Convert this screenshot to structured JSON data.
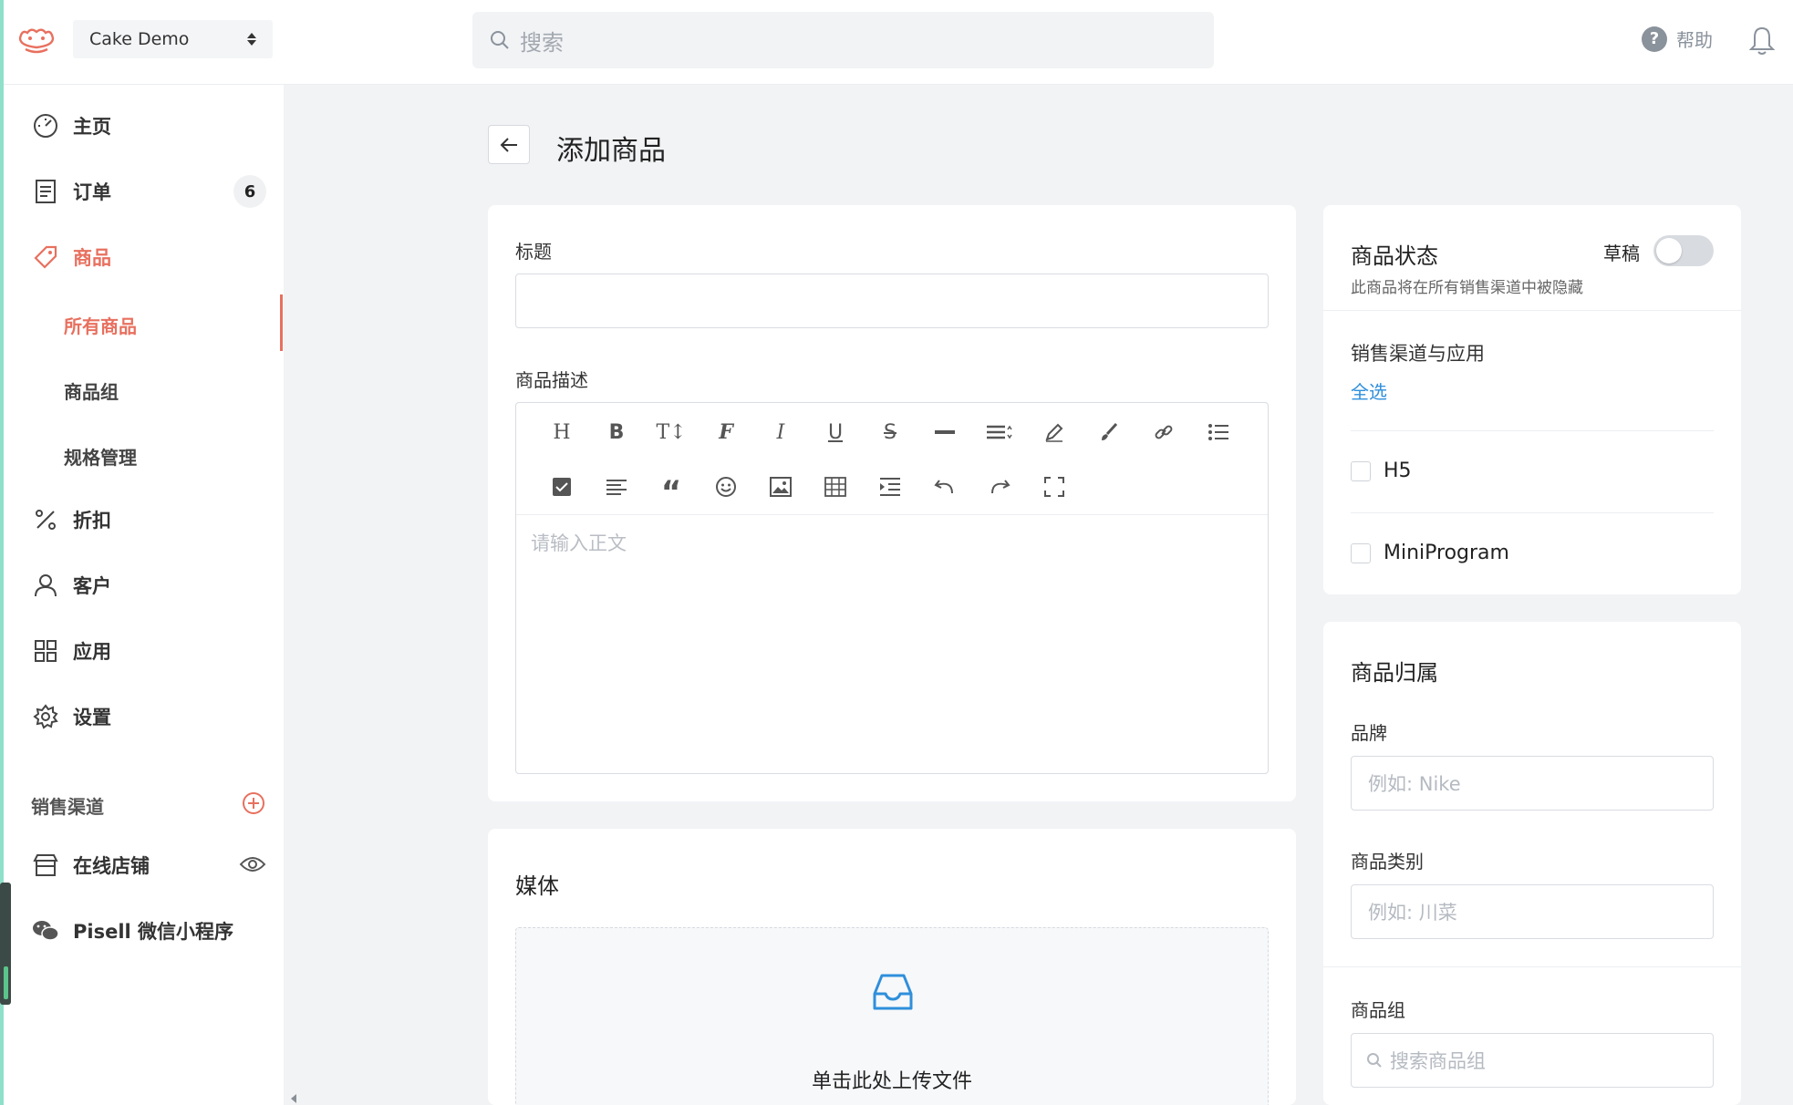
{
  "header": {
    "store_name": "Cake Demo",
    "search_placeholder": "搜索",
    "help_label": "帮助"
  },
  "sidebar": {
    "items": [
      {
        "id": "home",
        "label": "主页"
      },
      {
        "id": "orders",
        "label": "订单",
        "badge": "6"
      },
      {
        "id": "products",
        "label": "商品"
      },
      {
        "id": "discounts",
        "label": "折扣"
      },
      {
        "id": "customers",
        "label": "客户"
      },
      {
        "id": "apps",
        "label": "应用"
      },
      {
        "id": "settings",
        "label": "设置"
      }
    ],
    "product_sub": [
      "所有商品",
      "商品组",
      "规格管理"
    ],
    "channels_label": "销售渠道",
    "channels": [
      {
        "id": "online-store",
        "label": "在线店铺"
      },
      {
        "id": "wechat",
        "label": "Pisell 微信小程序"
      }
    ]
  },
  "page": {
    "title": "添加商品"
  },
  "main_card": {
    "title_label": "标题",
    "title_value": "",
    "description_label": "商品描述",
    "editor_placeholder": "请输入正文"
  },
  "media_card": {
    "title": "媒体",
    "upload_text": "单击此处上传文件"
  },
  "status_card": {
    "title": "商品状态",
    "subtitle": "此商品将在所有销售渠道中被隐藏",
    "draft_label": "草稿",
    "draft_on": false,
    "channels_title": "销售渠道与应用",
    "select_all": "全选",
    "channels": [
      {
        "label": "H5",
        "checked": false
      },
      {
        "label": "MiniProgram",
        "checked": false
      }
    ]
  },
  "ownership_card": {
    "title": "商品归属",
    "brand_label": "品牌",
    "brand_placeholder": "例如: Nike",
    "category_label": "商品类别",
    "category_placeholder": "例如: 川菜",
    "group_label": "商品组",
    "group_placeholder": "搜索商品组"
  },
  "colors": {
    "accent": "#e8705f",
    "link": "#2f8fdb",
    "upload_icon": "#2f8fdb"
  }
}
